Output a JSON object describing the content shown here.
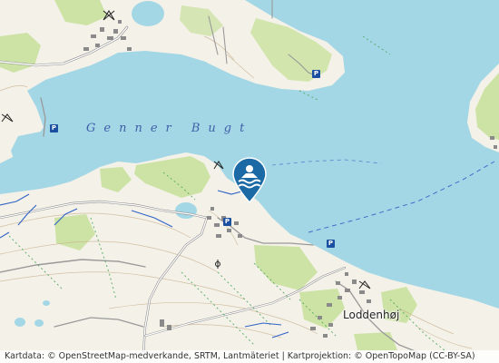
{
  "map": {
    "bay_label": "Genner Bugt",
    "place_label": "Loddenhøj",
    "parking_sign": "P",
    "attribution": "Kartdata: © OpenStreetMap-medverkande, SRTM, Lantmäteriet | Kartprojektion: © OpenTopoMap (CC-BY-SA)",
    "marker_icon": "swimming-icon",
    "colors": {
      "water": "#a4d7e6",
      "land": "#f4f1e8",
      "forest": "#cde3a6",
      "marker": "#1b6aa6",
      "parking": "#1b4fa0",
      "label": "#3f5fa8"
    }
  }
}
